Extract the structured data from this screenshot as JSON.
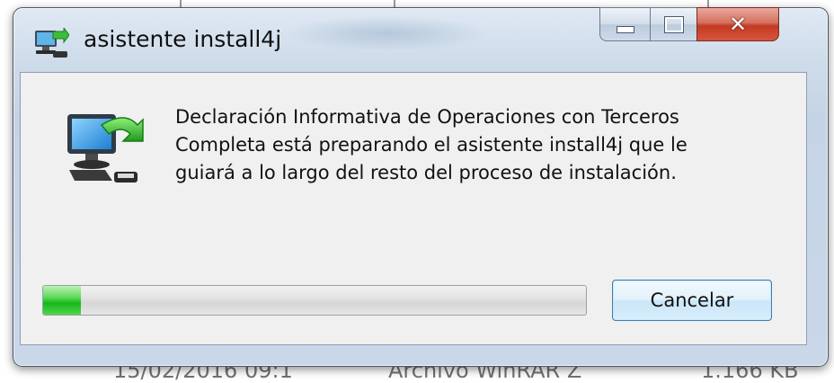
{
  "window": {
    "title": "asistente install4j",
    "app_icon": "installer-icon",
    "buttons": {
      "minimize": "minimize-icon",
      "maximize": "maximize-icon",
      "close": "✕"
    }
  },
  "dialog": {
    "icon": "computer-setup-icon",
    "message_lines": [
      "Declaración Informativa de Operaciones con Terceros",
      "Completa está preparando el asistente install4j que le",
      "guiará a lo largo del resto del proceso de instalación."
    ],
    "progress_fraction": 0.07,
    "cancel_label": "Cancelar"
  },
  "background": {
    "partial_text_left": "15/02/2016 09:1",
    "partial_text_mid": "Archivo WinRAR Z",
    "partial_text_right": "1.166 KB"
  },
  "colors": {
    "progress_green": "#16b81c",
    "close_red": "#c33a22",
    "frame_blue": "#c9d7e8"
  }
}
